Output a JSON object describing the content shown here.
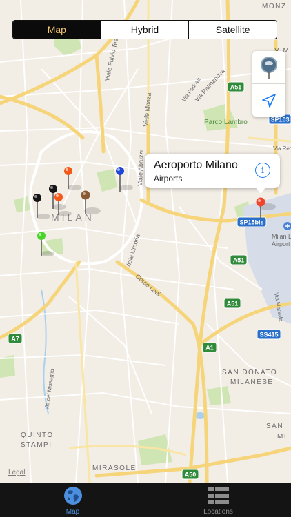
{
  "map": {
    "city_label": "MILAN",
    "streets": [
      {
        "name": "Viale Fulvio Testi"
      },
      {
        "name": "Viale Monza"
      },
      {
        "name": "Via Palmanova"
      },
      {
        "name": "Via Padova"
      },
      {
        "name": "Viale Abruzzi"
      },
      {
        "name": "Viale Umbria"
      },
      {
        "name": "Corso Lodi"
      },
      {
        "name": "Via del Missaglia"
      },
      {
        "name": "Via Rede"
      },
      {
        "name": "Via Marsala"
      }
    ],
    "places": [
      {
        "name": "Parco Lambro"
      },
      {
        "name": "Milan L"
      },
      {
        "name": "Airport"
      },
      {
        "name": "SAN DONATO"
      },
      {
        "name": "MILANESE"
      },
      {
        "name": "QUINTO"
      },
      {
        "name": "STAMPI"
      },
      {
        "name": "MIRASOLE"
      },
      {
        "name": "SAN"
      },
      {
        "name": "MI"
      },
      {
        "name": "VIM"
      },
      {
        "name": "MONZ"
      }
    ],
    "road_shields": [
      {
        "label": "A51"
      },
      {
        "label": "SP103"
      },
      {
        "label": "SP15bis"
      },
      {
        "label": "A51"
      },
      {
        "label": "A51"
      },
      {
        "label": "SS415"
      },
      {
        "label": "A1"
      },
      {
        "label": "A7"
      },
      {
        "label": "A50"
      }
    ],
    "legal_label": "Legal",
    "pin_colors": {
      "red": "#f2442a",
      "orange": "#f25a1c",
      "black": "#151515",
      "brown": "#8a5a34",
      "blue": "#2046d8",
      "green": "#4ad52c"
    }
  },
  "segmented_control": {
    "options": [
      "Map",
      "Hybrid",
      "Satellite"
    ],
    "selected": "Map"
  },
  "map_tools": {
    "pin_tool_icon": "pin-drop-icon",
    "locate_icon": "location-arrow-icon"
  },
  "callout": {
    "title": "Aeroporto Milano",
    "subtitle": "Airports",
    "info_icon": "i"
  },
  "tab_bar": {
    "tabs": [
      {
        "label": "Map",
        "icon": "globe-icon",
        "active": true
      },
      {
        "label": "Locations",
        "icon": "list-icon",
        "active": false
      }
    ]
  },
  "colors": {
    "accent": "#4c8fde",
    "segment_active_text": "#f2c46d",
    "tab_bar_bg": "#141414",
    "info_blue": "#1c7cf4"
  }
}
